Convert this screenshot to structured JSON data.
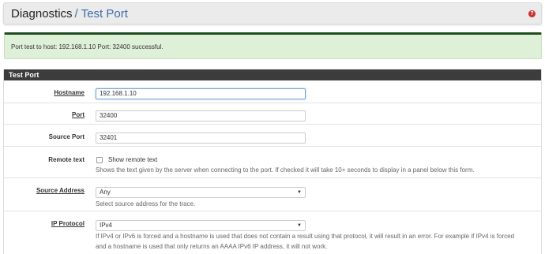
{
  "header": {
    "section": "Diagnostics",
    "separator": "/",
    "page": "Test Port",
    "help_icon": "question-circle-icon"
  },
  "alert": {
    "message": "Port test to host: 192.168.1.10 Port: 32400 successful."
  },
  "panel": {
    "title": "Test Port",
    "hostname": {
      "label": "Hostname",
      "value": "192.168.1.10"
    },
    "port": {
      "label": "Port",
      "value": "32400"
    },
    "source_port": {
      "label": "Source Port",
      "value": "32401"
    },
    "remote_text": {
      "label": "Remote text",
      "checkbox_label": "Show remote text",
      "help": "Shows the text given by the server when connecting to the port. If checked it will take 10+ seconds to display in a panel below this form."
    },
    "source_address": {
      "label": "Source Address",
      "value": "Any",
      "help": "Select source address for the trace."
    },
    "ip_protocol": {
      "label": "IP Protocol",
      "value": "IPv4",
      "help_line1": "If IPv4 or IPv6 is forced and a hostname is used that does not contain a result using that protocol, it will result in an error. For example if IPv4 is forced",
      "help_line2": "and a hostname is used that only returns an AAAA IPv6 IP address, it will not work."
    }
  }
}
